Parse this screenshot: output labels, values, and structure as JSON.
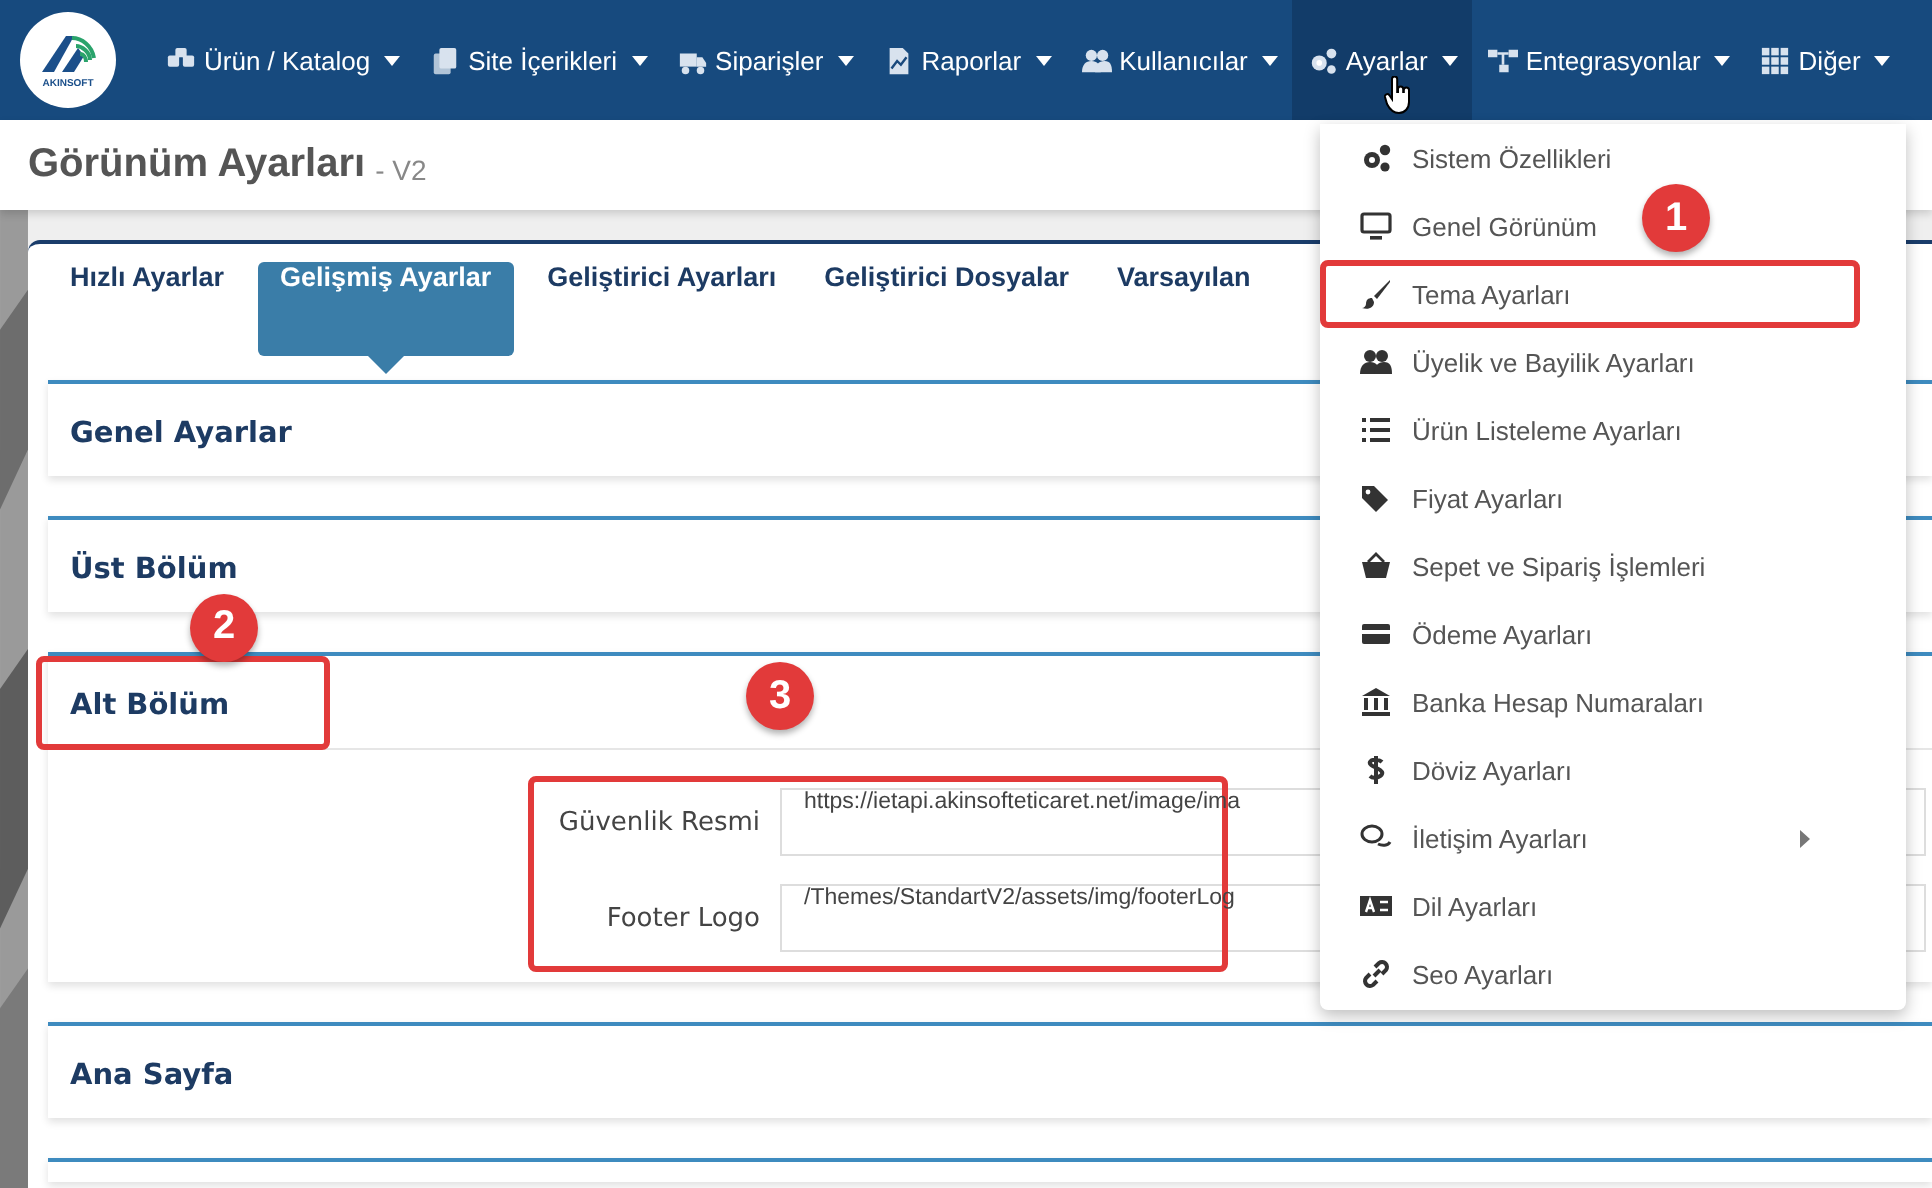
{
  "navbar": {
    "logo": {
      "caption": "AKINSOFT"
    },
    "items": [
      {
        "label": "Ürün / Katalog",
        "selected": false
      },
      {
        "label": "Site İçerikleri",
        "selected": false
      },
      {
        "label": "Siparişler",
        "selected": false
      },
      {
        "label": "Raporlar",
        "selected": false
      },
      {
        "label": "Kullanıcılar",
        "selected": false
      },
      {
        "label": "Ayarlar",
        "selected": true
      },
      {
        "label": "Entegrasyonlar",
        "selected": false
      },
      {
        "label": "Diğer",
        "selected": false
      }
    ]
  },
  "page_header": {
    "title": "Görünüm Ayarları",
    "subtitle": "- V2"
  },
  "tabs": [
    {
      "label": "Hızlı Ayarlar",
      "selected": false
    },
    {
      "label": "Gelişmiş Ayarlar",
      "selected": true
    },
    {
      "label": "Geliştirici Ayarları",
      "selected": false
    },
    {
      "label": "Geliştirici Dosyalar",
      "selected": false
    },
    {
      "label": "Varsayılan",
      "selected": false
    }
  ],
  "panels": [
    {
      "title": "Genel Ayarlar",
      "expanded": false
    },
    {
      "title": "Üst Bölüm",
      "expanded": false
    },
    {
      "title": "Alt Bölüm",
      "expanded": true,
      "callout": "2",
      "fields_callout": "3",
      "fields": [
        {
          "label": "Güvenlik Resmi",
          "value": "https://ietapi.akinsofteticaret.net/image/ima"
        },
        {
          "label": "Footer Logo",
          "value": "/Themes/StandartV2/assets/img/footerLog"
        }
      ]
    },
    {
      "title": "Ana Sayfa",
      "expanded": false
    }
  ],
  "dropdown": {
    "callout": "1",
    "items": [
      {
        "label": "Sistem Özellikleri",
        "has_submenu": false,
        "highlighted": false
      },
      {
        "label": "Genel Görünüm",
        "has_submenu": false,
        "highlighted": false
      },
      {
        "label": "Tema Ayarları",
        "has_submenu": false,
        "highlighted": true
      },
      {
        "label": "Üyelik ve Bayilik Ayarları",
        "has_submenu": false,
        "highlighted": false
      },
      {
        "label": "Ürün Listeleme Ayarları",
        "has_submenu": false,
        "highlighted": false
      },
      {
        "label": "Fiyat Ayarları",
        "has_submenu": false,
        "highlighted": false
      },
      {
        "label": "Sepet ve Sipariş İşlemleri",
        "has_submenu": false,
        "highlighted": false
      },
      {
        "label": "Ödeme Ayarları",
        "has_submenu": false,
        "highlighted": false
      },
      {
        "label": "Banka Hesap Numaraları",
        "has_submenu": false,
        "highlighted": false
      },
      {
        "label": "Döviz Ayarları",
        "has_submenu": false,
        "highlighted": false
      },
      {
        "label": "İletişim Ayarları",
        "has_submenu": true,
        "highlighted": false
      },
      {
        "label": "Dil Ayarları",
        "has_submenu": false,
        "highlighted": false
      },
      {
        "label": "Seo Ayarları",
        "has_submenu": false,
        "highlighted": false
      }
    ]
  }
}
